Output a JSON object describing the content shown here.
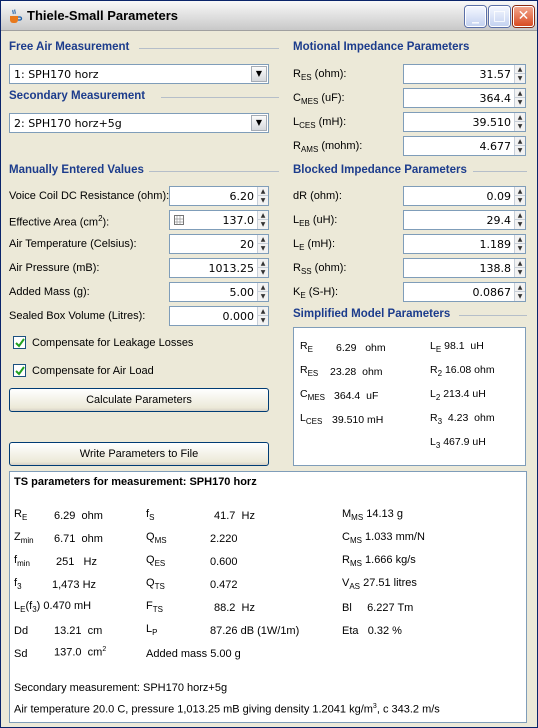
{
  "window": {
    "title": "Thiele-Small Parameters"
  },
  "free_air": {
    "heading": "Free Air Measurement",
    "selected": "1: SPH170 horz"
  },
  "secondary": {
    "heading": "Secondary Measurement",
    "selected": "2: SPH170 horz+5g"
  },
  "manual": {
    "heading": "Manually Entered Values",
    "fields": [
      {
        "label": "Voice Coil DC Resistance (ohm):",
        "value": "6.20"
      },
      {
        "label": "Effective Area (cm",
        "sup": "2",
        "suffix": "):",
        "value": "137.0"
      },
      {
        "label": "Air Temperature (Celsius):",
        "value": "20"
      },
      {
        "label": "Air Pressure (mB):",
        "value": "1013.25"
      },
      {
        "label": "Added Mass (g):",
        "value": "5.00"
      },
      {
        "label": "Sealed Box Volume (Litres):",
        "value": "0.000"
      }
    ],
    "checkbox_leakage": "Compensate for Leakage Losses",
    "checkbox_airload": "Compensate for Air Load",
    "calc_button": "Calculate Parameters",
    "write_button": "Write Parameters to File"
  },
  "motional": {
    "heading": "Motional Impedance Parameters",
    "fields": [
      {
        "sym": "R",
        "sub": "ES",
        "unit": " (ohm):",
        "value": "31.57"
      },
      {
        "sym": "C",
        "sub": "MES",
        "unit": " (uF):",
        "value": "364.4"
      },
      {
        "sym": "L",
        "sub": "CES",
        "unit": " (mH):",
        "value": "39.510"
      },
      {
        "sym": "R",
        "sub": "AMS",
        "unit": " (mohm):",
        "value": "4.677"
      }
    ]
  },
  "blocked": {
    "heading": "Blocked Impedance Parameters",
    "fields": [
      {
        "sym": "dR",
        "sub": "",
        "unit": " (ohm):",
        "value": "0.09"
      },
      {
        "sym": "L",
        "sub": "EB",
        "unit": " (uH):",
        "value": "29.4"
      },
      {
        "sym": "L",
        "sub": "E",
        "unit": " (mH):",
        "value": "1.189"
      },
      {
        "sym": "R",
        "sub": "SS",
        "unit": " (ohm):",
        "value": "138.8"
      },
      {
        "sym": "K",
        "sub": "E",
        "unit": " (S-H):",
        "value": "0.0867"
      }
    ]
  },
  "simplified": {
    "heading": "Simplified Model Parameters",
    "left": [
      {
        "sym": "R",
        "sub": "E",
        "val": "6.29",
        "unit": "ohm"
      },
      {
        "sym": "R",
        "sub": "ES",
        "val": "23.28",
        "unit": "ohm"
      },
      {
        "sym": "C",
        "sub": "MES",
        "val": "364.4",
        "unit": "uF"
      },
      {
        "sym": "L",
        "sub": "CES",
        "val": "39.510",
        "unit": "mH"
      }
    ],
    "right": [
      {
        "sym": "L",
        "sub": "E",
        "val": "98.1",
        "unit": "uH"
      },
      {
        "sym": "R",
        "sub": "2",
        "val": "16.08",
        "unit": "ohm"
      },
      {
        "sym": "L",
        "sub": "2",
        "val": "213.4",
        "unit": "uH"
      },
      {
        "sym": "R",
        "sub": "3",
        "val": "4.23",
        "unit": "ohm"
      },
      {
        "sym": "L",
        "sub": "3",
        "val": "467.9",
        "unit": "uH"
      }
    ]
  },
  "output": {
    "title": "TS parameters for measurement: SPH170 horz",
    "col1": [
      {
        "sym": "R",
        "sub": "E",
        "val": "6.29",
        "unit": "ohm"
      },
      {
        "sym": "Z",
        "sub": "min",
        "val": "6.71",
        "unit": "ohm"
      },
      {
        "sym": "f",
        "sub": "min",
        "val": "251",
        "unit": "Hz"
      },
      {
        "sym": "f",
        "sub": "3",
        "val": "1,473",
        "unit": "Hz"
      },
      {
        "sym": "L",
        "sub": "E",
        "extra": "(f",
        "extra_sub": "3",
        "extra_end": ")",
        "val": "0.470",
        "unit": "mH"
      },
      {
        "sym": "Dd",
        "sub": "",
        "val": "13.21",
        "unit": "cm"
      },
      {
        "sym": "Sd",
        "sub": "",
        "val": "137.0",
        "unit": "cm",
        "sup": "2"
      }
    ],
    "col2": [
      {
        "sym": "f",
        "sub": "S",
        "val": "41.7",
        "unit": "Hz"
      },
      {
        "sym": "Q",
        "sub": "MS",
        "val": "2.220",
        "unit": ""
      },
      {
        "sym": "Q",
        "sub": "ES",
        "val": "0.600",
        "unit": ""
      },
      {
        "sym": "Q",
        "sub": "TS",
        "val": "0.472",
        "unit": ""
      },
      {
        "sym": "F",
        "sub": "TS",
        "val": "88.2",
        "unit": "Hz"
      },
      {
        "sym": "L",
        "sub": "P",
        "val": "87.26 dB (1W/1m)",
        "unit": ""
      }
    ],
    "added_mass": "Added mass  5.00  g",
    "col3": [
      {
        "sym": "M",
        "sub": "MS",
        "val": "14.13 g"
      },
      {
        "sym": "C",
        "sub": "MS",
        "val": "1.033 mm/N"
      },
      {
        "sym": "R",
        "sub": "MS",
        "val": "1.666 kg/s"
      },
      {
        "sym": "V",
        "sub": "AS",
        "val": "27.51 litres"
      },
      {
        "sym": "Bl",
        "sub": "",
        "val": "6.227 Tm"
      },
      {
        "sym": "Eta",
        "sub": "",
        "val": "0.32  %"
      }
    ],
    "secondary_line": "Secondary measurement: SPH170 horz+5g",
    "air_line_a": "Air temperature 20.0 C, pressure 1,013.25 mB giving density 1.2041 kg/m",
    "air_line_sup": "3",
    "air_line_b": ", c 343.2 m/s"
  }
}
